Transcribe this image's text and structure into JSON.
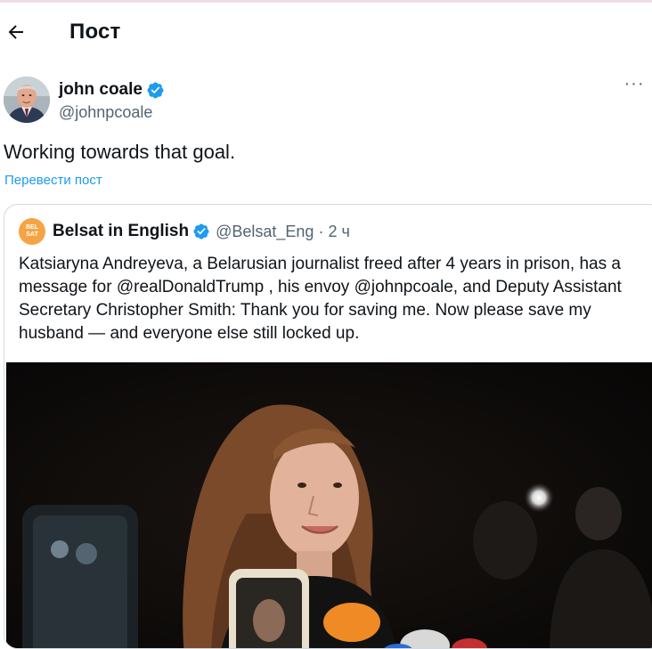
{
  "header": {
    "title": "Пост",
    "back_icon": "arrow-left-icon"
  },
  "post": {
    "author_name": "john coale",
    "author_handle": "@johnpcoale",
    "verified_icon": "verified-badge-icon",
    "more_icon": "more-horizontal-icon",
    "text": "Working towards that goal.",
    "translate_label": "Перевести пост"
  },
  "quoted": {
    "logo_line1": "BEL",
    "logo_line2": "SAT",
    "name": "Belsat in English",
    "handle": "@Belsat_Eng",
    "separator": "·",
    "time": "2 ч",
    "text": "Katsiaryna Andreyeva, a Belarusian journalist freed after 4 years in prison, has a message for @realDonaldTrump , his envoy @johnpcoale, and Deputy Assistant Secretary Christopher Smith: Thank you for saving me. Now please save my husband — and everyone else still locked up."
  },
  "colors": {
    "accent": "#1d9bf0",
    "secondary_text": "#536471",
    "border": "#cfd9de",
    "belsat_brand": "#f6a443"
  }
}
